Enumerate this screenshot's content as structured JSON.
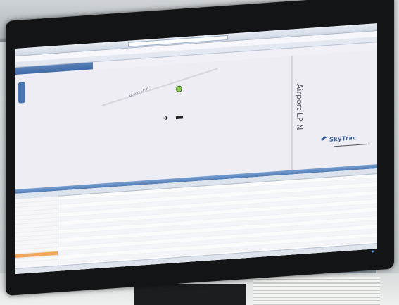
{
  "map": {
    "road_label_left": "Airport LP N",
    "road_label_right": "Airport LP N"
  },
  "logo": {
    "text": "SkyTrac"
  },
  "colors": {
    "bezel": "#121416",
    "screen_bg": "#f1f0f6",
    "accent_blue": "#4f7ab5",
    "highlight_orange": "#f2a65a",
    "target_green": "#8bc34a"
  },
  "icons": {
    "aircraft": "aircraft-icon",
    "target": "target-marker-icon",
    "nav": "map-navigation-icon",
    "logo": "skytrac-logo-icon"
  }
}
